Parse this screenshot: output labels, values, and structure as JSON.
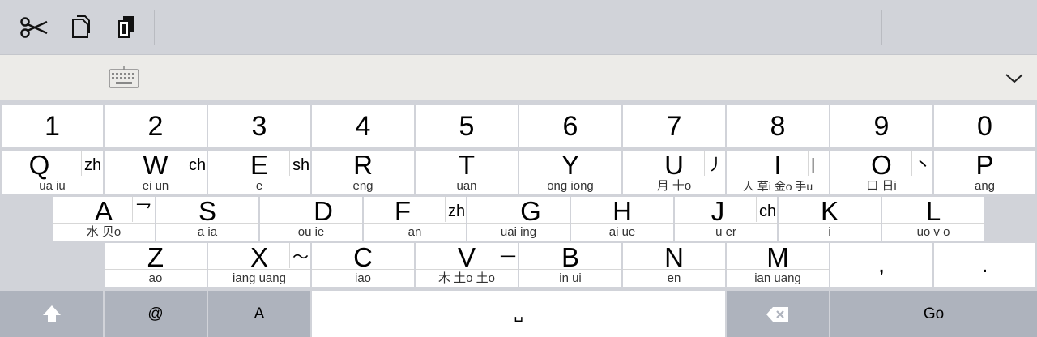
{
  "toolbar": {
    "icons": [
      "scissors-icon",
      "copy-icon",
      "paste-icon"
    ]
  },
  "candidates": {
    "icons": [
      "keyboard-icon",
      "chevron-down-icon"
    ]
  },
  "numbers": [
    "1",
    "2",
    "3",
    "4",
    "5",
    "6",
    "7",
    "8",
    "9",
    "0"
  ],
  "row1": [
    {
      "key": "Q",
      "alt": "zh",
      "sub": "ua   iu"
    },
    {
      "key": "W",
      "alt": "ch",
      "sub": "ei   un"
    },
    {
      "key": "E",
      "alt": "sh",
      "sub": "e"
    },
    {
      "key": "R",
      "alt": "",
      "sub": "eng"
    },
    {
      "key": "T",
      "alt": "",
      "sub": "uan"
    },
    {
      "key": "Y",
      "alt": "",
      "sub": "ong   iong"
    },
    {
      "key": "U",
      "alt": "丿",
      "sub": "月   十o"
    },
    {
      "key": "I",
      "alt": "|",
      "sub": "人   草i   金o   手u"
    },
    {
      "key": "O",
      "alt": "丶",
      "sub": "口   日i"
    },
    {
      "key": "P",
      "alt": "",
      "sub": "ang"
    }
  ],
  "row2": [
    {
      "key": "A",
      "alt": "乛",
      "sub": "水   贝o"
    },
    {
      "key": "S",
      "alt": "",
      "sub": "a   ia"
    },
    {
      "key": "D",
      "alt": "",
      "sub": "ou   ie"
    },
    {
      "key": "F",
      "alt": "zh",
      "sub": "an"
    },
    {
      "key": "G",
      "alt": "",
      "sub": "uai   ing"
    },
    {
      "key": "H",
      "alt": "",
      "sub": "ai   ue"
    },
    {
      "key": "J",
      "alt": "ch",
      "sub": "u   er"
    },
    {
      "key": "K",
      "alt": "",
      "sub": "i"
    },
    {
      "key": "L",
      "alt": "",
      "sub": "uo   v   o"
    }
  ],
  "row3": [
    {
      "key": "Z",
      "alt": "",
      "sub": "ao"
    },
    {
      "key": "X",
      "alt": "～",
      "sub": "iang   uang"
    },
    {
      "key": "C",
      "alt": "",
      "sub": "iao"
    },
    {
      "key": "V",
      "alt": "一",
      "sub": "木   土o   土o"
    },
    {
      "key": "B",
      "alt": "",
      "sub": "in   ui"
    },
    {
      "key": "N",
      "alt": "",
      "sub": "en"
    },
    {
      "key": "M",
      "alt": "",
      "sub": "ian   uang"
    }
  ],
  "punct": [
    ",",
    "."
  ],
  "bottom": {
    "shift_icon": "shift-arrow-icon",
    "at": "@",
    "abc": "A",
    "space": "␣",
    "delete_icon": "delete-icon",
    "go": "Go"
  },
  "colors": {
    "key_white": "#ffffff",
    "key_gray": "#aeb3bd",
    "background": "#d1d3d9"
  }
}
